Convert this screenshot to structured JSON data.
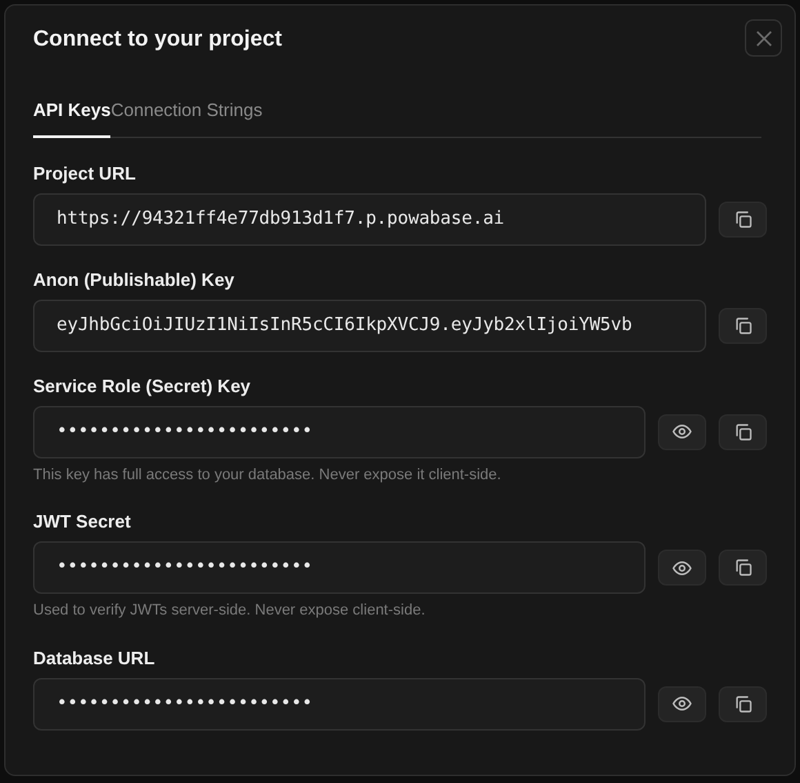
{
  "dialog": {
    "title": "Connect to your project"
  },
  "tabs": [
    {
      "label": "API Keys",
      "selected": true
    },
    {
      "label": "Connection Strings",
      "selected": false
    }
  ],
  "fields": [
    {
      "kind": "plain",
      "label": "Project URL",
      "value": "https://94321ff4e77db913d1f7.p.powabase.ai"
    },
    {
      "kind": "plain",
      "label": "Anon (Publishable) Key",
      "value": "eyJhbGciOiJIUzI1NiIsInR5cCI6IkpXVCJ9.eyJyb2xlIjoiYW5vb"
    },
    {
      "kind": "secret",
      "label": "Service Role (Secret) Key",
      "value": "••••••••••••••••••••••••",
      "hint": "This key has full access to your database. Never expose it client-side."
    },
    {
      "kind": "secret",
      "label": "JWT Secret",
      "value": "••••••••••••••••••••••••",
      "hint": "Used to verify JWTs server-side. Never expose client-side."
    },
    {
      "kind": "secret",
      "label": "Database URL",
      "value": "••••••••••••••••••••••••"
    }
  ]
}
